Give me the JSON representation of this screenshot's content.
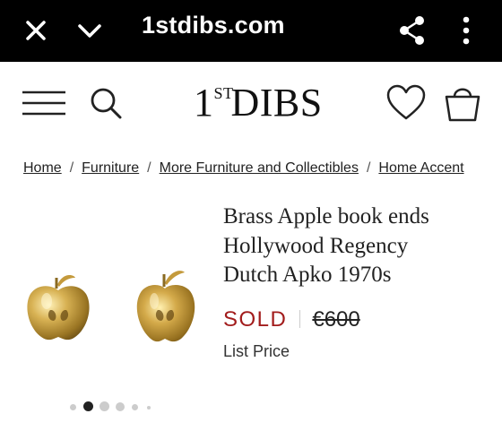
{
  "browser": {
    "domain": "1stdibs.com",
    "icons": [
      "close-icon",
      "chevron-down-icon",
      "share-icon",
      "more-vert-icon"
    ]
  },
  "header": {
    "logo": {
      "one": "1",
      "st": "ST",
      "dibs": "DIBS"
    },
    "icons": [
      "menu-icon",
      "search-icon",
      "heart-icon",
      "shopping-bag-icon"
    ]
  },
  "breadcrumb": {
    "items": [
      "Home",
      "Furniture",
      "More Furniture and Collectibles",
      "Home Accent"
    ],
    "separator": "/"
  },
  "product": {
    "title_lines": [
      "Brass Apple book ends",
      "Hollywood Regency",
      "Dutch Apko 1970s"
    ],
    "status": "SOLD",
    "price": "€600",
    "price_label": "List Price",
    "image_count": 6,
    "active_image_index": 1
  },
  "colors": {
    "topbar_bg": "#000000",
    "sold_red": "#a21c1c",
    "brass": "#c9a24a"
  }
}
